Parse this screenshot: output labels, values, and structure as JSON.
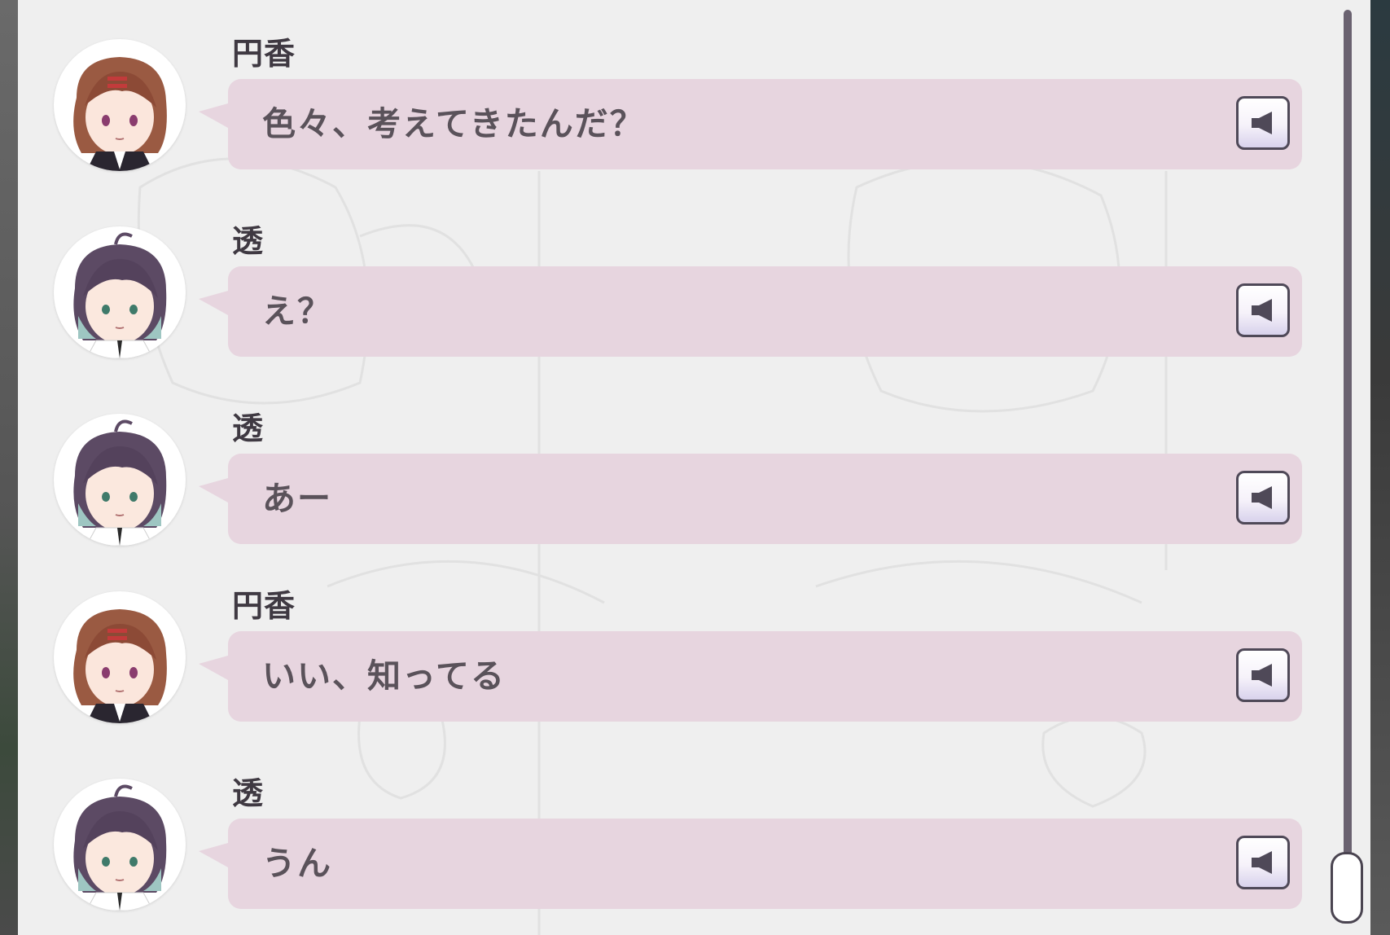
{
  "backlog": {
    "entries": [
      {
        "speaker": "円香",
        "text": "色々、考えてきたんだ？",
        "avatar_icon": "madoka-avatar-icon"
      },
      {
        "speaker": "透",
        "text": "え？",
        "avatar_icon": "toru-avatar-icon"
      },
      {
        "speaker": "透",
        "text": "あー",
        "avatar_icon": "toru-avatar-icon"
      },
      {
        "speaker": "円香",
        "text": "いい、知ってる",
        "avatar_icon": "madoka-avatar-icon"
      },
      {
        "speaker": "透",
        "text": "うん",
        "avatar_icon": "toru-avatar-icon"
      }
    ],
    "voice_icon": "speaker-icon"
  },
  "scrollbar": {
    "position_fraction": 1.0
  },
  "colors": {
    "panel_bg": "#efefef",
    "bubble_bg": "#e7d5df",
    "speaker_text": "#3f3942",
    "line_text": "#5a525a",
    "button_border": "#4f4958",
    "scroll_track": "#6a6270"
  }
}
